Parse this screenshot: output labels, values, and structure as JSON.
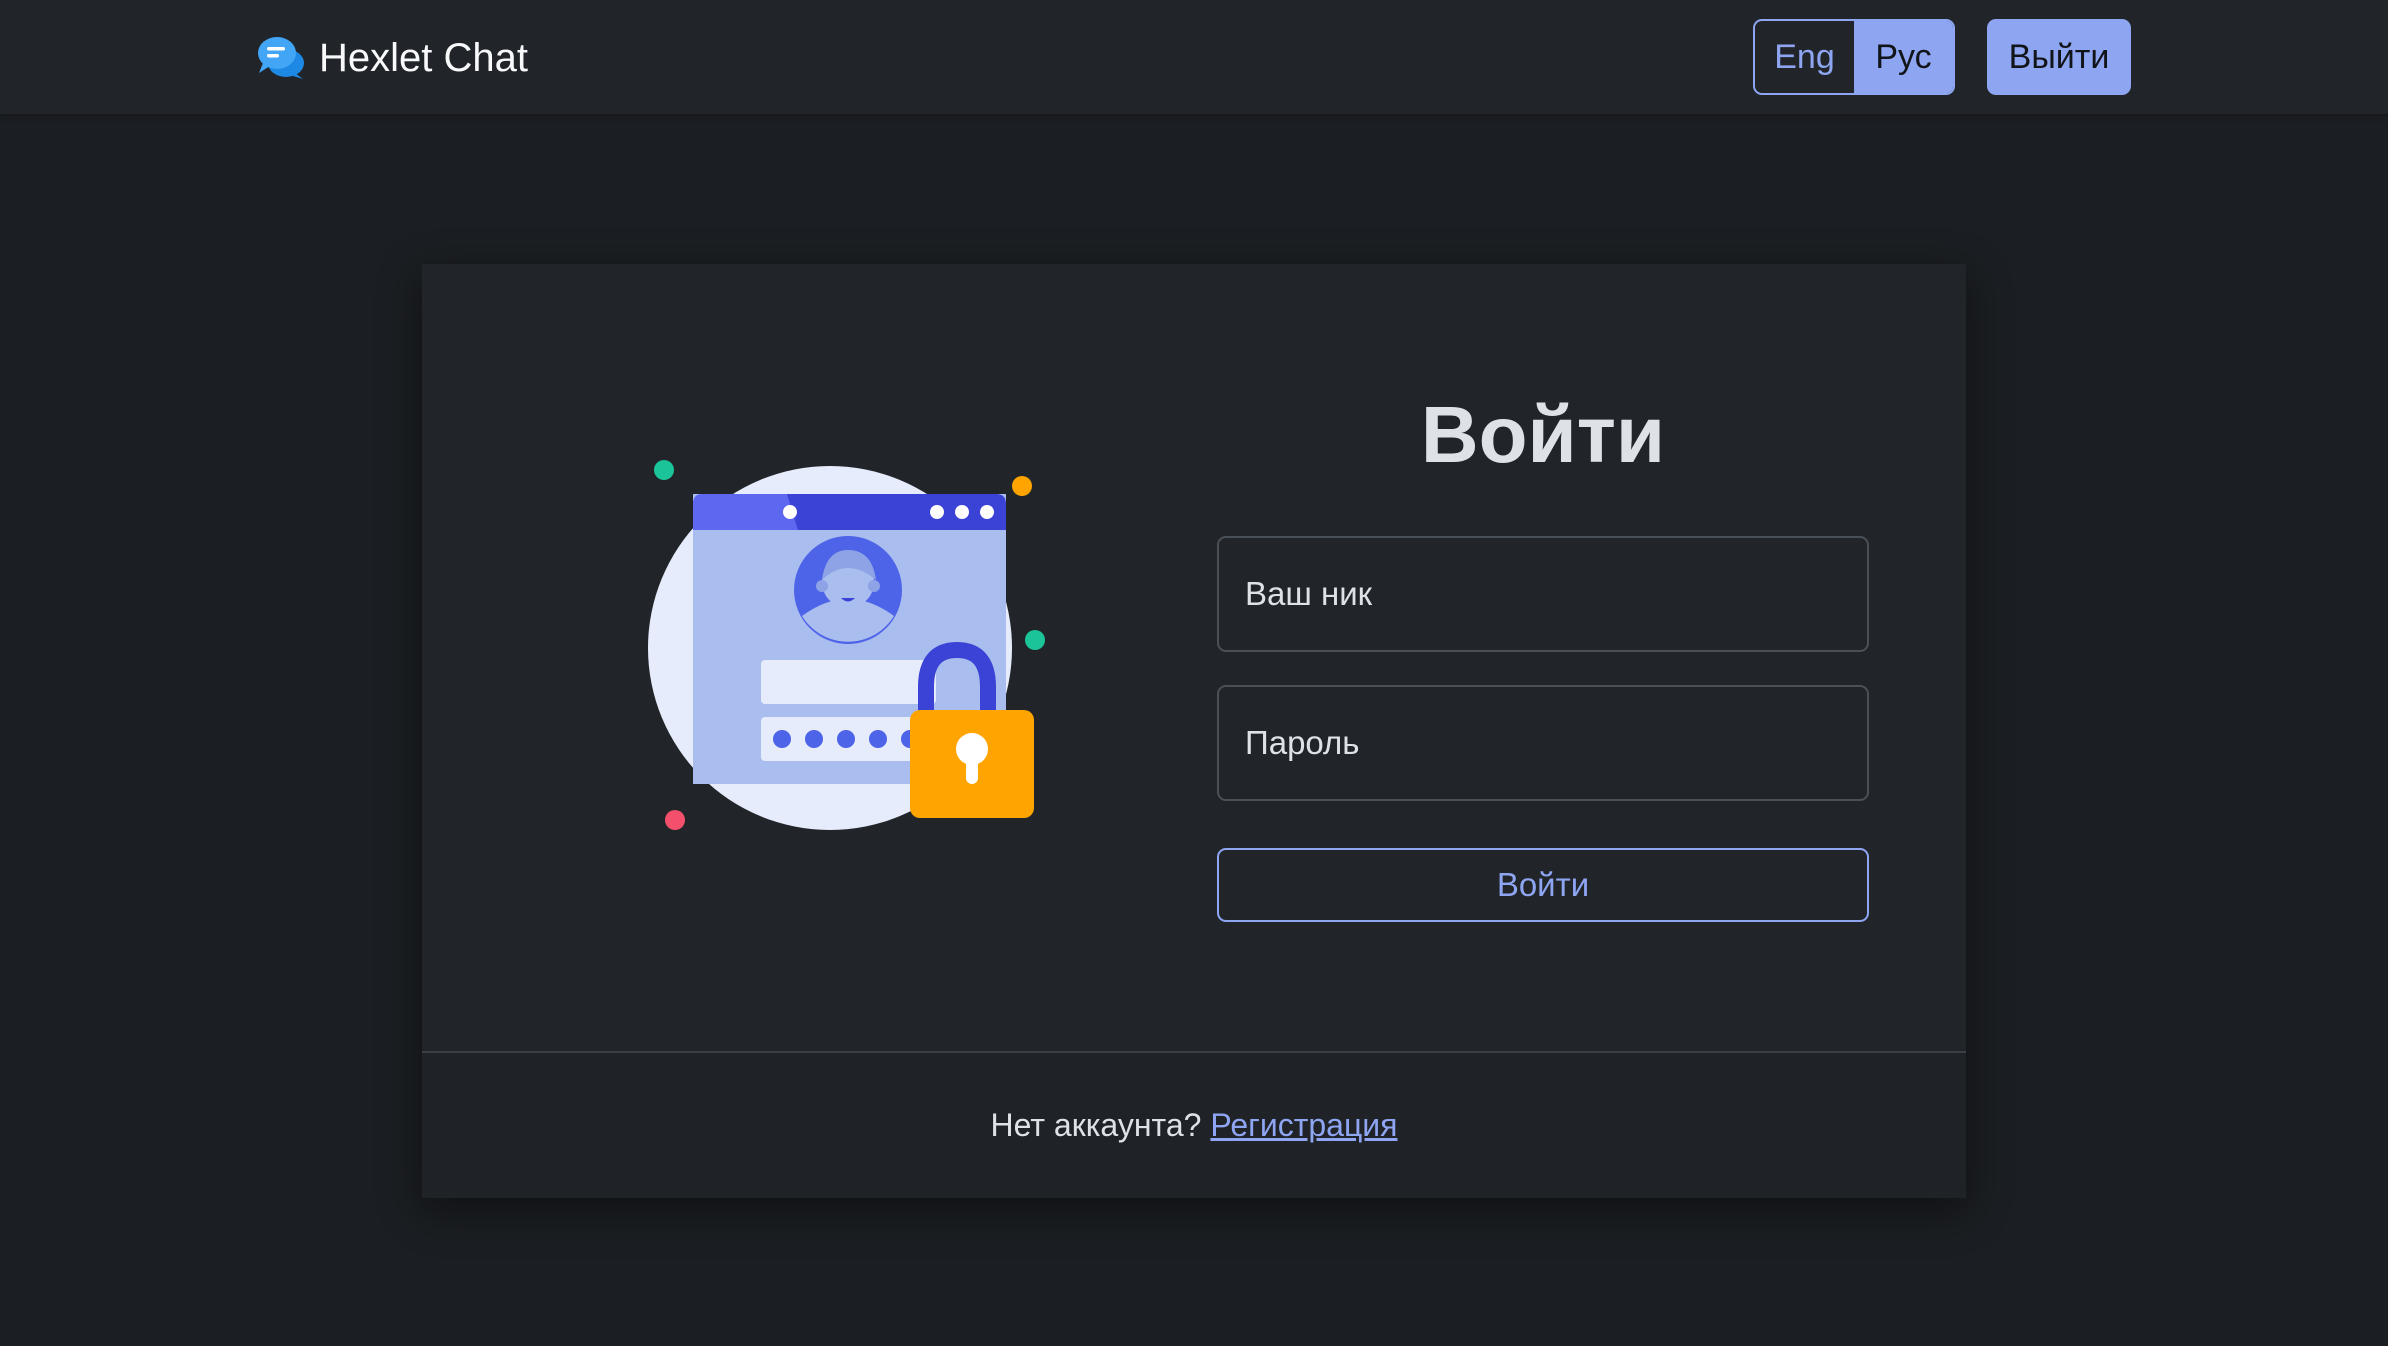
{
  "header": {
    "brand": "Hexlet Chat",
    "languages": [
      {
        "label": "Eng",
        "active": false
      },
      {
        "label": "Рус",
        "active": true
      }
    ],
    "logout_label": "Выйти"
  },
  "login_form": {
    "title": "Войти",
    "username_placeholder": "Ваш ник",
    "password_placeholder": "Пароль",
    "submit_label": "Войти"
  },
  "footer": {
    "text": "Нет аккаунта?",
    "link_label": "Регистрация"
  },
  "colors": {
    "background": "#1b1e22",
    "surface": "#212529",
    "accent": "#8ea5f2",
    "lock": "#ffa400"
  },
  "icons": {
    "brand": "chat-bubbles-icon",
    "illustration": "login-illustration"
  }
}
